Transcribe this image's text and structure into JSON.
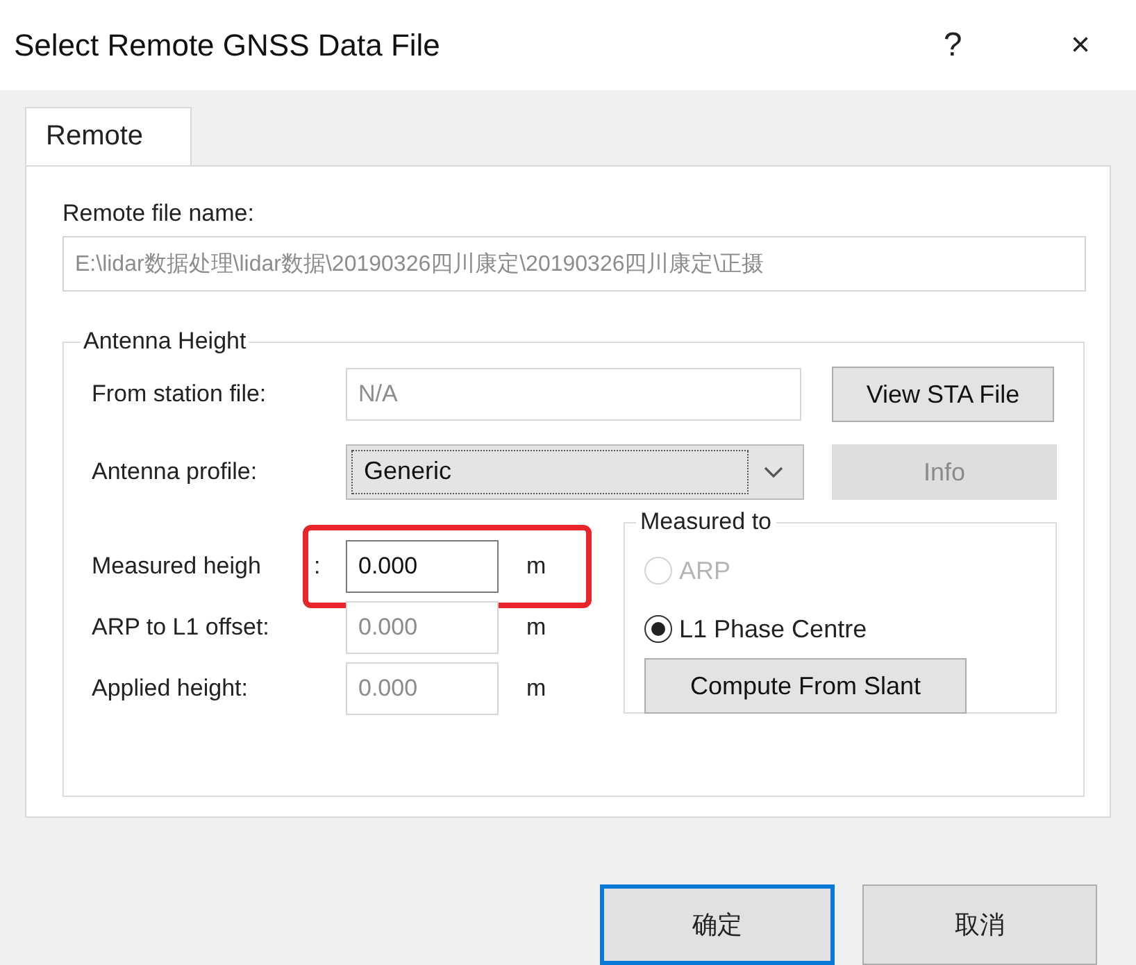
{
  "window": {
    "title": "Select Remote GNSS Data File",
    "help": "?",
    "close": "×"
  },
  "tabs": [
    {
      "label": "Remote",
      "selected": true
    }
  ],
  "file": {
    "label": "Remote file name:",
    "value": "E:\\lidar数据处理\\lidar数据\\20190326四川康定\\20190326四川康定\\正摄",
    "disabled": true
  },
  "antenna": {
    "title": "Antenna Height",
    "station": {
      "label": "From station file:",
      "value": "N/A",
      "disabled": true
    },
    "view_button": {
      "label": "View STA File",
      "disabled": false
    },
    "profile": {
      "label": "Antenna profile:",
      "value": "Generic"
    },
    "info_button": {
      "label": "Info",
      "disabled": true
    },
    "heights": [
      {
        "label": "Measured heigh",
        "label_tail": ":",
        "value": "0.000",
        "unit": "m",
        "disabled": false,
        "highlighted": true
      },
      {
        "label": "ARP to L1 offset:",
        "value": "0.000",
        "unit": "m",
        "disabled": true,
        "highlighted": false
      },
      {
        "label": "Applied height:",
        "value": "0.000",
        "unit": "m",
        "disabled": true,
        "highlighted": false
      }
    ],
    "measured_to": {
      "title": "Measured to",
      "options": [
        {
          "label": "ARP",
          "selected": false,
          "disabled": true
        },
        {
          "label": "L1 Phase Centre",
          "selected": true,
          "disabled": false
        }
      ],
      "compute_button": "Compute From Slant"
    }
  },
  "buttons": [
    {
      "label": "确定",
      "default": true
    },
    {
      "label": "取消",
      "default": false
    }
  ]
}
